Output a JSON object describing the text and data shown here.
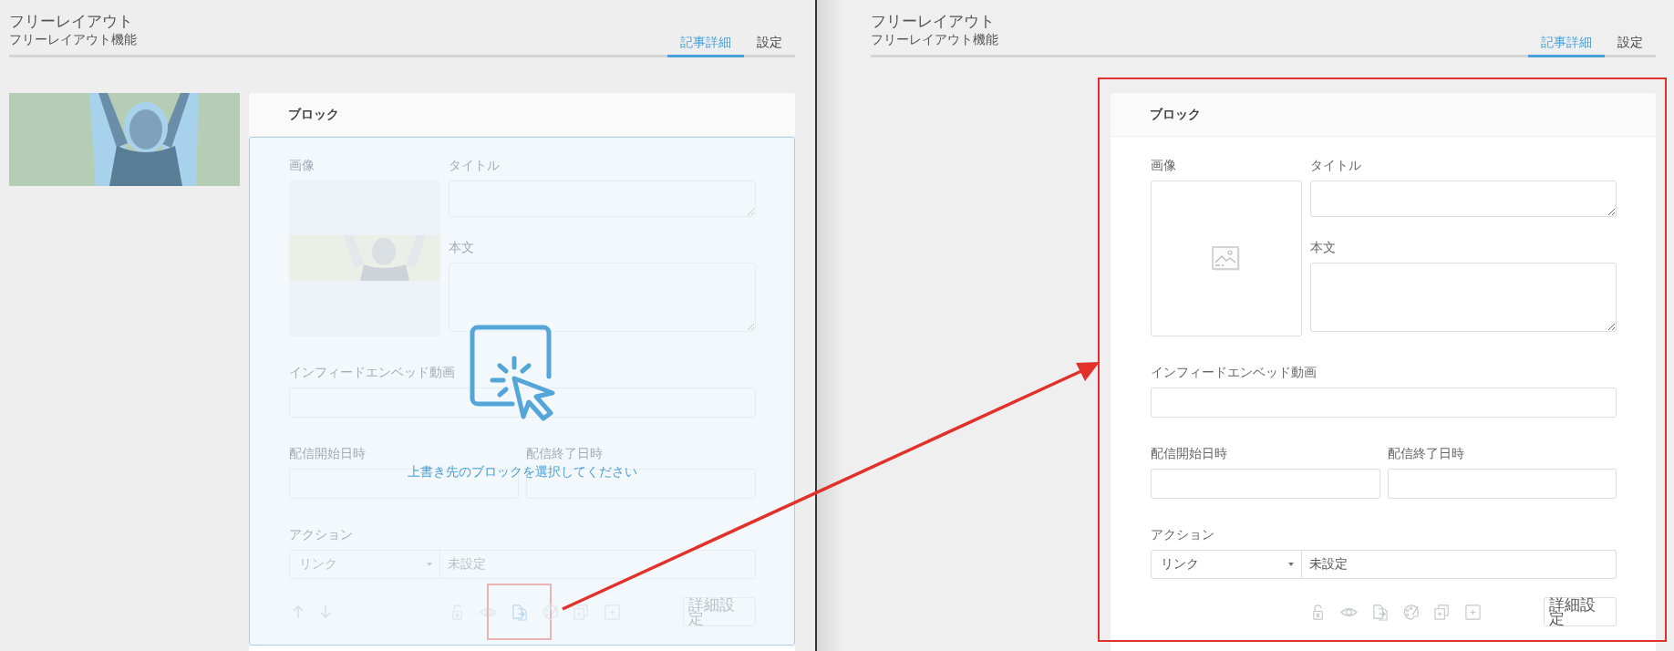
{
  "panels": [
    {
      "title": "フリーレイアウト",
      "subtitle": "フリーレイアウト機能",
      "tabs": [
        {
          "label": "記事詳細",
          "selected": true
        },
        {
          "label": "設定",
          "selected": false
        }
      ],
      "outlined": false,
      "block": {
        "heading": "ブロック",
        "image_label": "画像",
        "title_label": "タイトル",
        "body_label": "本文",
        "embed_label": "インフィードエンベッド動画",
        "start_label": "配信開始日時",
        "end_label": "配信終了日時",
        "action_label": "アクション",
        "action_type": "リンク",
        "action_value": "未設定",
        "detail_button": "詳細設定",
        "reorder_arrows": true,
        "tools": [
          {
            "kind": "lock",
            "active": false,
            "boxed": false
          },
          {
            "kind": "eye",
            "active": false,
            "boxed": false
          },
          {
            "kind": "copy",
            "active": true,
            "boxed": true
          },
          {
            "kind": "palette",
            "active": false,
            "boxed": false
          },
          {
            "kind": "duplicate",
            "active": false,
            "boxed": false
          },
          {
            "kind": "add",
            "active": false,
            "boxed": false
          }
        ],
        "overlay": {
          "message": "上書き先のブロックを選択してください"
        }
      }
    },
    {
      "title": "フリーレイアウト",
      "subtitle": "フリーレイアウト機能",
      "tabs": [
        {
          "label": "記事詳細",
          "selected": true
        },
        {
          "label": "設定",
          "selected": false
        }
      ],
      "outlined": true,
      "block": {
        "heading": "ブロック",
        "image_label": "画像",
        "image": {
          "kind": "empty"
        },
        "title_label": "タイトル",
        "body_label": "本文",
        "embed_label": "インフィードエンベッド動画",
        "start_label": "配信開始日時",
        "end_label": "配信終了日時",
        "action_label": "アクション",
        "action_type": "リンク",
        "action_value": "未設定",
        "detail_button": "詳細設定",
        "reorder_arrows": false,
        "tools": [
          {
            "kind": "lock",
            "active": false,
            "boxed": false
          },
          {
            "kind": "eye",
            "active": false,
            "boxed": false
          },
          {
            "kind": "copy",
            "active": false,
            "boxed": false
          },
          {
            "kind": "palette",
            "active": false,
            "boxed": false
          },
          {
            "kind": "duplicate",
            "active": false,
            "boxed": false
          },
          {
            "kind": "add",
            "active": false,
            "boxed": false
          }
        ]
      }
    }
  ]
}
